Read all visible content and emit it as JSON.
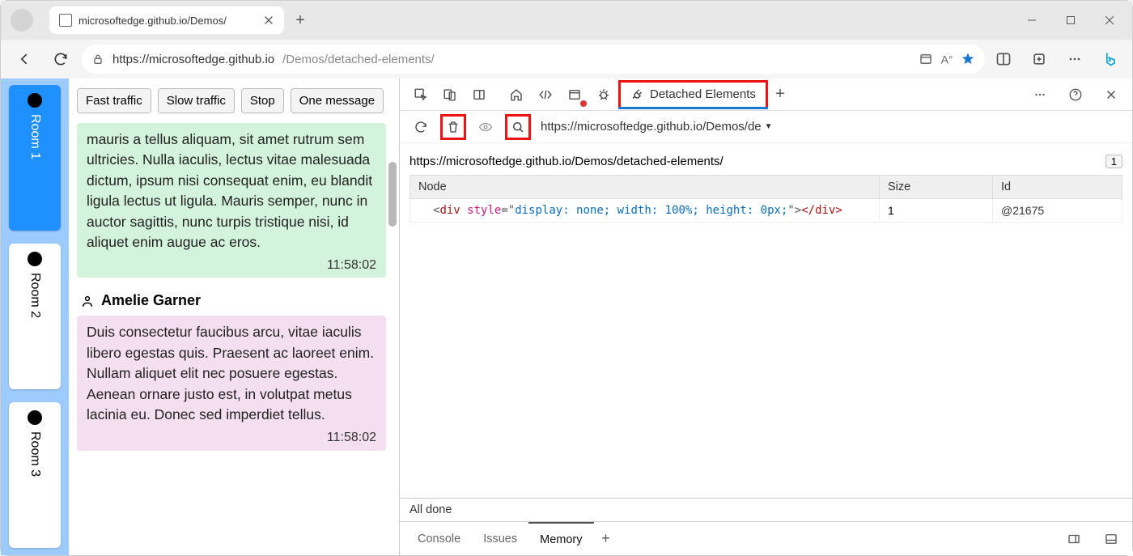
{
  "browser": {
    "tab_title": "microsoftedge.github.io/Demos/",
    "url_host": "https://microsoftedge.github.io",
    "url_path": "/Demos/detached-elements/"
  },
  "demo": {
    "rooms": [
      "Room 1",
      "Room 2",
      "Room 3"
    ],
    "active_room": 0,
    "toolbar": {
      "fast": "Fast traffic",
      "slow": "Slow traffic",
      "stop": "Stop",
      "one": "One message"
    },
    "msg1_text": "mauris a tellus aliquam, sit amet rutrum sem ultricies. Nulla iaculis, lectus vitae malesuada dictum, ipsum nisi consequat enim, eu blandit ligula lectus ut ligula. Mauris semper, nunc in auctor sagittis, nunc turpis tristique nisi, id aliquet enim augue ac eros.",
    "msg1_time": "11:58:02",
    "sender2": "Amelie Garner",
    "msg2_text": "Duis consectetur faucibus arcu, vitae iaculis libero egestas quis. Praesent ac laoreet enim. Nullam aliquet elit nec posuere egestas. Aenean ornare justo est, in volutpat metus lacinia eu. Donec sed imperdiet tellus.",
    "msg2_time": "11:58:02"
  },
  "devtools": {
    "tab_label": "Detached Elements",
    "frame_url_short": "https://microsoftedge.github.io/Demos/de",
    "page_url": "https://microsoftedge.github.io/Demos/detached-elements/",
    "count": "1",
    "table": {
      "h1": "Node",
      "h2": "Size",
      "h3": "Id"
    },
    "row": {
      "lt": "<",
      "tag": "div",
      "sp": " ",
      "attr": "style",
      "eq": "=",
      "q": "\"",
      "val": "display: none; width: 100%; height: 0px;",
      "gt": ">",
      "ctag": "</div>",
      "size": "1",
      "id": "@21675"
    },
    "status": "All done",
    "drawer": {
      "console": "Console",
      "issues": "Issues",
      "memory": "Memory"
    }
  }
}
